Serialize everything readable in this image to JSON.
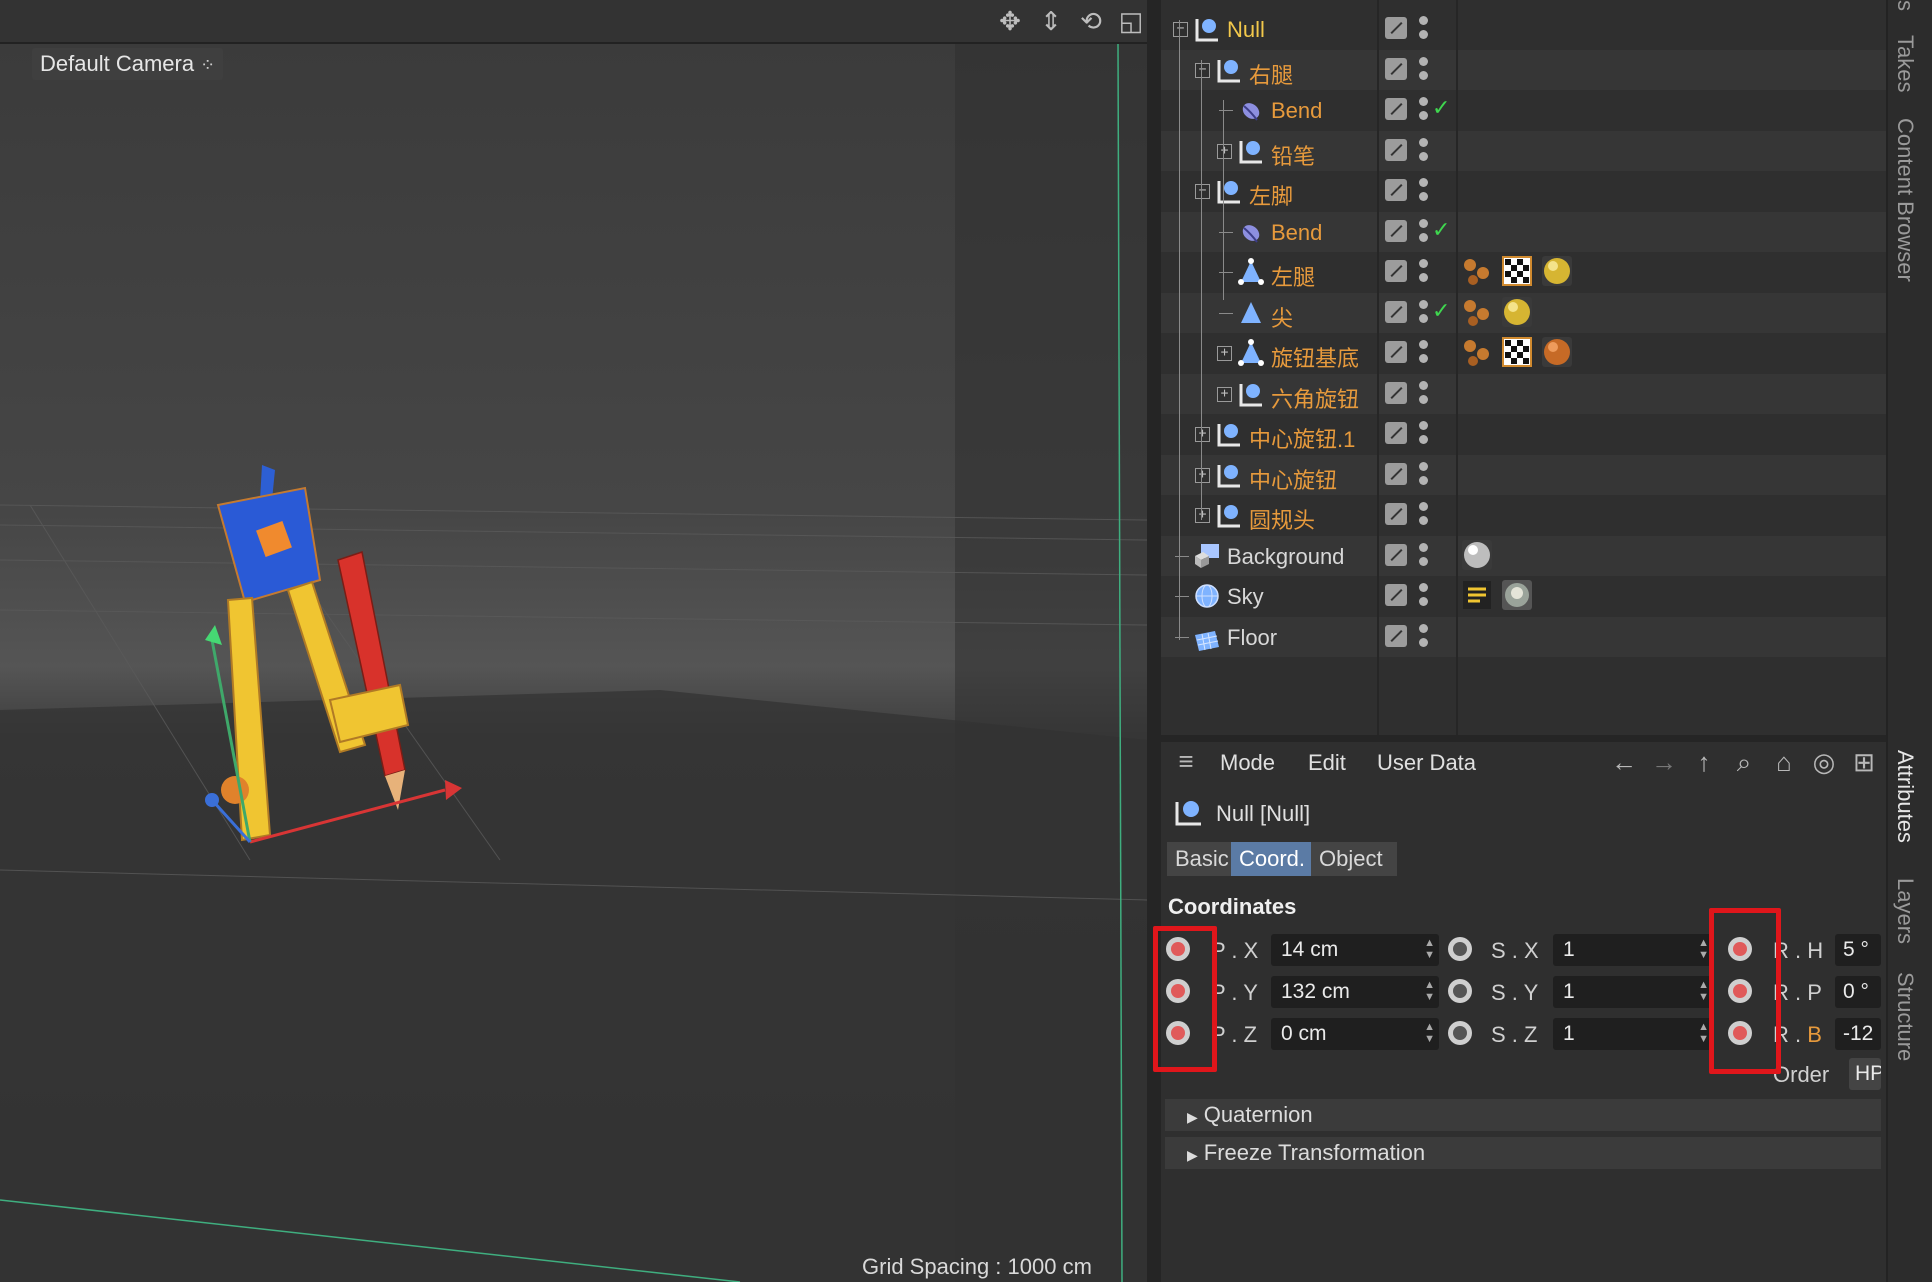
{
  "viewport": {
    "camera_label": "Default Camera",
    "grid_spacing": "Grid Spacing : 1000 cm"
  },
  "object_manager": {
    "rows": [
      {
        "name": "Null",
        "color": "#f2c84b"
      },
      {
        "name": "右腿",
        "color": "#e79a3c"
      },
      {
        "name": "Bend",
        "color": "#e79a3c"
      },
      {
        "name": "铅笔",
        "color": "#e79a3c"
      },
      {
        "name": "左脚",
        "color": "#e79a3c"
      },
      {
        "name": "Bend",
        "color": "#e79a3c"
      },
      {
        "name": "左腿",
        "color": "#e79a3c"
      },
      {
        "name": "尖",
        "color": "#e79a3c"
      },
      {
        "name": "旋钮基底",
        "color": "#e79a3c"
      },
      {
        "name": "六角旋钮",
        "color": "#e79a3c"
      },
      {
        "name": "中心旋钮.1",
        "color": "#e79a3c"
      },
      {
        "name": "中心旋钮",
        "color": "#e79a3c"
      },
      {
        "name": "圆规头",
        "color": "#e79a3c"
      },
      {
        "name": "Background",
        "color": "#d8d8d8"
      },
      {
        "name": "Sky",
        "color": "#d8d8d8"
      },
      {
        "name": "Floor",
        "color": "#d8d8d8"
      }
    ]
  },
  "attributes": {
    "menu": {
      "mode": "Mode",
      "edit": "Edit",
      "user_data": "User Data"
    },
    "object_title": "Null [Null]",
    "tabs": {
      "basic": "Basic",
      "coord": "Coord.",
      "object": "Object"
    },
    "section_title": "Coordinates",
    "fields": {
      "px_label": "P . X",
      "px_value": "14 cm",
      "py_label": "P . Y",
      "py_value": "132 cm",
      "pz_label": "P . Z",
      "pz_value": "0 cm",
      "sx_label": "S . X",
      "sx_value": "1",
      "sy_label": "S . Y",
      "sy_value": "1",
      "sz_label": "S . Z",
      "sz_value": "1",
      "rh_label": "R . H",
      "rh_value": "5 °",
      "rp_label": "R . P",
      "rp_value": "0 °",
      "rb_label_r": "R . ",
      "rb_label_b": "B",
      "rb_value": "-12",
      "order_label": "Order",
      "order_value": "HPB"
    },
    "collapsed_sections": {
      "quaternion": "Quaternion",
      "freeze": "Freeze Transformation"
    }
  },
  "side_tabs": {
    "top_fragment": "s",
    "takes": "Takes",
    "content_browser": "Content Browser",
    "attributes": "Attributes",
    "layers": "Layers",
    "structure": "Structure"
  },
  "colors": {
    "highlight_red": "#e0161b",
    "active_tab": "#5b7ba5",
    "record_dot": "#e05a5a"
  }
}
